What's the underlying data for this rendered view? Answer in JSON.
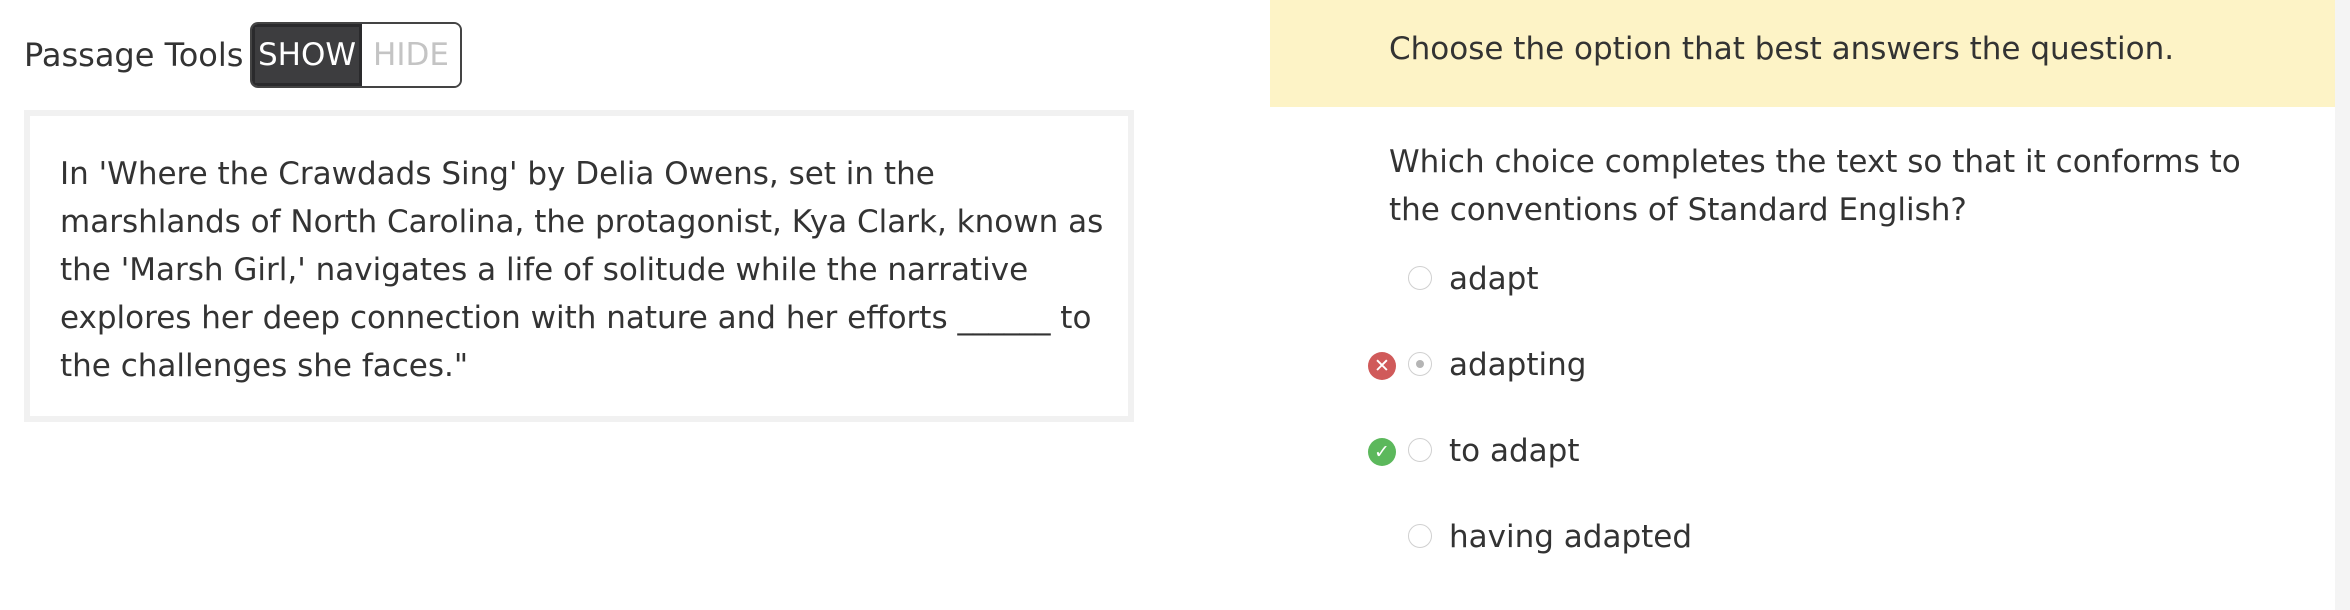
{
  "passage_tools": {
    "label": "Passage Tools",
    "show_label": "SHOW",
    "hide_label": "HIDE",
    "selected": "SHOW"
  },
  "passage": {
    "text": "In 'Where the Crawdads Sing' by Delia Owens, set in the marshlands of North Carolina, the protagonist, Kya Clark, known as the 'Marsh Girl,' navigates a life of solitude while the narrative explores her deep connection with nature and her efforts ______ to the challenges she faces.\""
  },
  "instruction": "Choose the option that best answers the question.",
  "question": "Which choice completes the text so that it conforms to the conventions of Standard English?",
  "options": [
    {
      "label": "adapt",
      "selected": false,
      "mark": null
    },
    {
      "label": "adapting",
      "selected": true,
      "mark": "incorrect"
    },
    {
      "label": "to adapt",
      "selected": false,
      "mark": "correct"
    },
    {
      "label": "having adapted",
      "selected": false,
      "mark": null
    }
  ],
  "icons": {
    "incorrect": "x-circle-icon",
    "correct": "check-circle-icon"
  },
  "colors": {
    "banner": "#fdf3c6",
    "incorrect": "#d05a5a",
    "correct": "#5cb85c",
    "toggle_active": "#3d3d3f"
  }
}
